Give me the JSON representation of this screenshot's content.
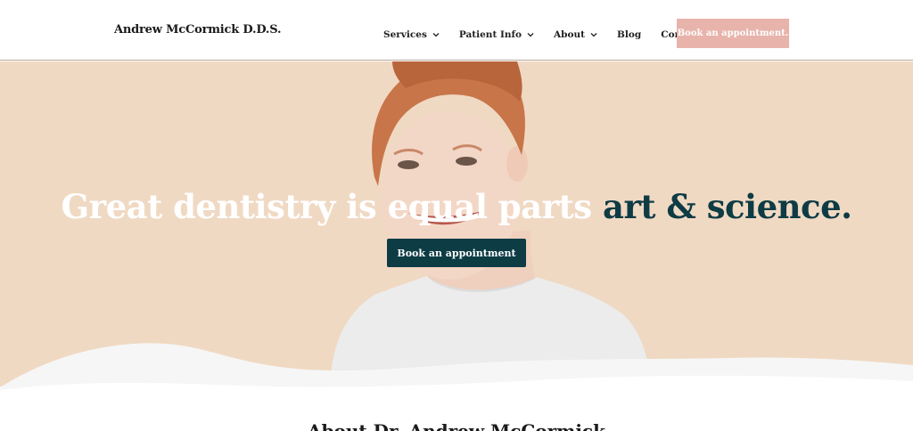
{
  "header": {
    "brand": "Andrew McCormick D.D.S.",
    "nav": [
      {
        "label": "Services",
        "has_dropdown": true
      },
      {
        "label": "Patient Info",
        "has_dropdown": true
      },
      {
        "label": "About",
        "has_dropdown": true
      },
      {
        "label": "Blog",
        "has_dropdown": false
      },
      {
        "label": "Contact",
        "has_dropdown": false
      }
    ],
    "cta_label": "Book an appointment."
  },
  "hero": {
    "headline_part1": "Great dentistry is equal parts",
    "headline_part2": "art & science.",
    "cta_label": "Book an appointment"
  },
  "about": {
    "title": "About Dr. Andrew McCormick"
  },
  "colors": {
    "hero_bg": "#f0d9c3",
    "accent_pink": "#e7b3aa",
    "dark_teal": "#0d3c45"
  }
}
